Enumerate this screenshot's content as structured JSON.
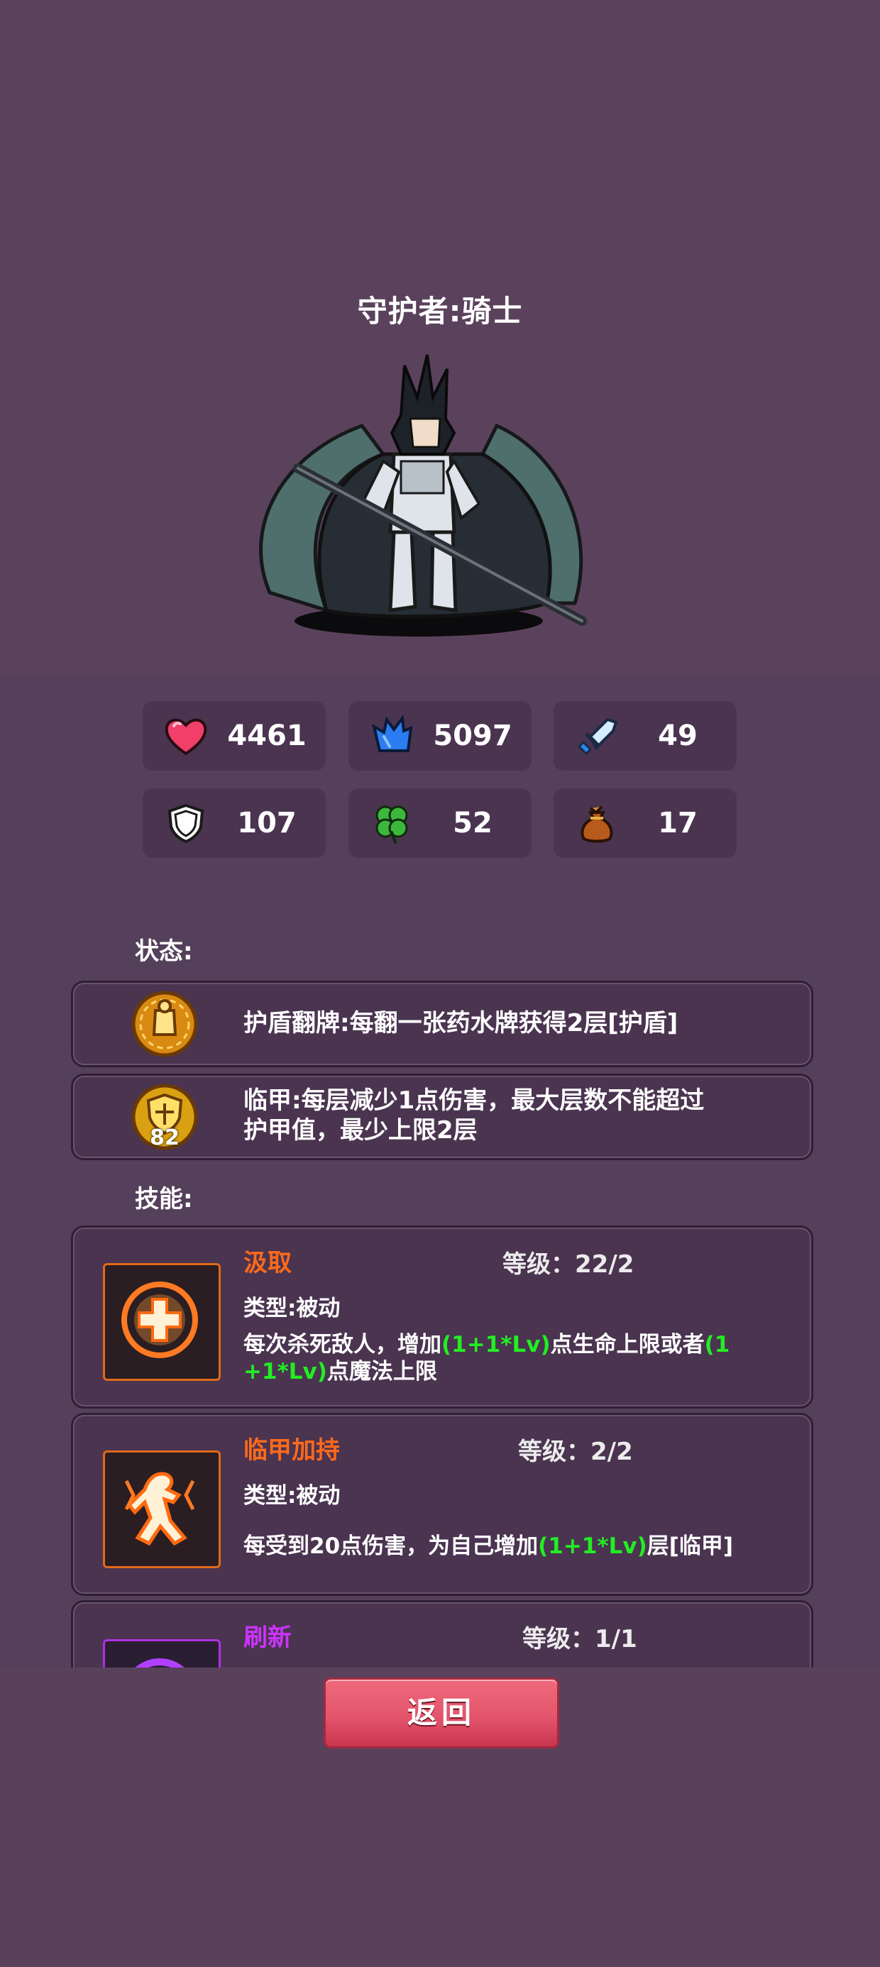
{
  "hero": {
    "title": "守护者:骑士"
  },
  "stats": [
    {
      "icon": "heart-icon",
      "value": "4461"
    },
    {
      "icon": "mana-crystal-icon",
      "value": "5097"
    },
    {
      "icon": "sword-icon",
      "value": "49"
    },
    {
      "icon": "shield-icon",
      "value": "107"
    },
    {
      "icon": "clover-icon",
      "value": "52"
    },
    {
      "icon": "money-bag-icon",
      "value": "17"
    }
  ],
  "status_section": {
    "label": "状态:",
    "items": [
      {
        "icon": "shield-flip-status-icon",
        "text": "护盾翻牌:每翻一张药水牌获得2层[护盾]"
      },
      {
        "icon": "armor-status-icon",
        "badge": "82",
        "text_line1": "临甲:每层减少1点伤害，最大层数不能超过",
        "text_line2": "护甲值，最少上限2层"
      }
    ]
  },
  "skills_section": {
    "label": "技能:",
    "items": [
      {
        "name": "汲取",
        "name_color": "#ff6a1a",
        "level": "等级：22/2",
        "type": "类型:被动",
        "desc_a": "每次杀死敌人，增加",
        "desc_b": "(1+1*Lv)",
        "desc_c": "点生命上限或者",
        "desc_d": "(1",
        "desc_e": "+1*Lv)",
        "desc_f": "点魔法上限"
      },
      {
        "name": "临甲加持",
        "name_color": "#ff6a1a",
        "level": "等级：2/2",
        "type": "类型:被动",
        "desc_a": "每受到20点伤害，为自己增加",
        "desc_b": "(1+1*Lv)",
        "desc_c": "层[临甲]"
      },
      {
        "name": "刷新",
        "name_color": "#cc33ff",
        "level": "等级：1/1"
      }
    ]
  },
  "back_button": {
    "label": "返回"
  },
  "colors": {
    "background": "#5a415b",
    "panel": "#4a3450",
    "skill_name_orange": "#ff6a1a",
    "skill_name_purple": "#cc33ff",
    "highlight_green": "#22ee22"
  }
}
